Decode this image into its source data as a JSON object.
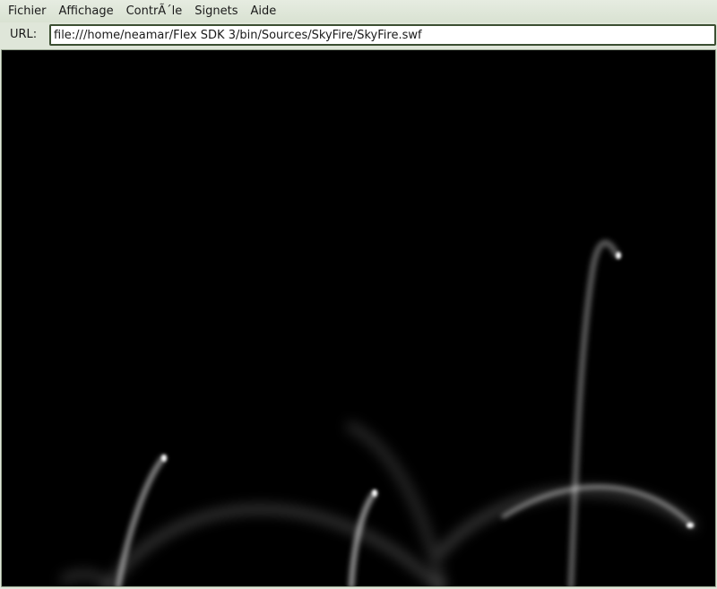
{
  "menubar": {
    "items": [
      {
        "label": "Fichier"
      },
      {
        "label": "Affichage"
      },
      {
        "label": "ContrÃ´le"
      },
      {
        "label": "Signets"
      },
      {
        "label": "Aide"
      }
    ]
  },
  "urlbar": {
    "label": "URL:",
    "value": "file:///home/neamar/Flex SDK 3/bin/Sources/SkyFire/SkyFire.swf"
  },
  "colors": {
    "background": "#000000",
    "trail": "#ffffff",
    "chrome": "#dfe6d9",
    "input_border": "#3c4f32"
  }
}
